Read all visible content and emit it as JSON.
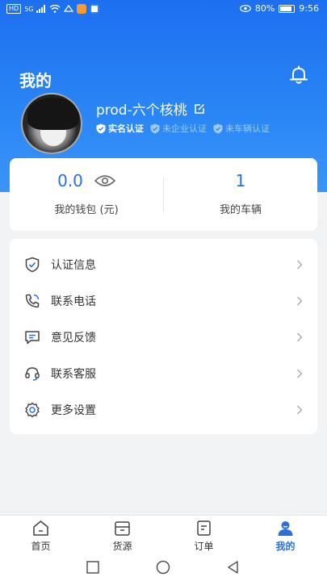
{
  "status_bar": {
    "network_chip": "HD",
    "signal": "5G",
    "battery_percent": "80%",
    "time": "9:56"
  },
  "header": {
    "title": "我的",
    "notification_icon": "bell-icon"
  },
  "profile": {
    "username": "prod-六个核桃",
    "badges": [
      {
        "label": "实名认证",
        "verified": true
      },
      {
        "label": "未企业认证",
        "verified": false
      },
      {
        "label": "未车辆认证",
        "verified": false
      }
    ]
  },
  "stats": {
    "wallet_value": "0.0",
    "wallet_label": "我的钱包 (元)",
    "vehicles_value": "1",
    "vehicles_label": "我的车辆"
  },
  "menu": [
    {
      "label": "认证信息",
      "icon": "shield-check-icon"
    },
    {
      "label": "联系电话",
      "icon": "phone-icon"
    },
    {
      "label": "意见反馈",
      "icon": "feedback-icon"
    },
    {
      "label": "联系客服",
      "icon": "headset-icon"
    },
    {
      "label": "更多设置",
      "icon": "gear-icon"
    }
  ],
  "tabs": [
    {
      "label": "首页",
      "icon": "home-icon",
      "active": false
    },
    {
      "label": "货源",
      "icon": "box-icon",
      "active": false
    },
    {
      "label": "订单",
      "icon": "order-icon",
      "active": false
    },
    {
      "label": "我的",
      "icon": "profile-icon",
      "active": true
    }
  ],
  "colors": {
    "primary": "#2b6fd8",
    "header_gradient_top": "#1d6ff0",
    "header_gradient_bottom": "#3a95f7",
    "background": "#f2f3f5"
  }
}
